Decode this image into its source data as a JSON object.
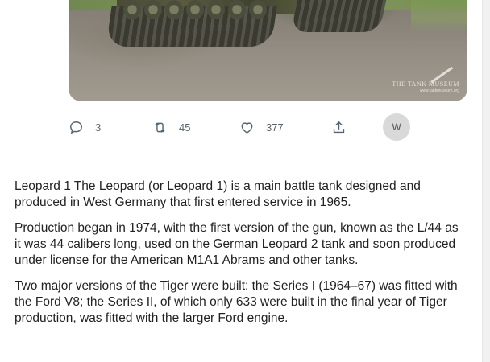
{
  "tweet": {
    "image": {
      "watermark_name": "THE TANK MUSEUM",
      "watermark_url": "www.tankmuseum.org"
    },
    "actions": {
      "reply_count": "3",
      "retweet_count": "45",
      "like_count": "377",
      "avatar_letter": "W"
    },
    "icons": {
      "reply": "comment-bubble-icon",
      "retweet": "retweet-icon",
      "like": "heart-icon",
      "share": "share-upload-icon"
    }
  },
  "article": {
    "paragraphs": [
      "Leopard 1 The Leopard (or Leopard 1) is a main battle tank designed and produced in West Germany that first entered service in 1965.",
      "Production began in 1974, with the first version of the gun, known as the L/44 as it was 44 calibers long, used on the German Leopard 2 tank and soon produced under license for the American M1A1 Abrams and other tanks.",
      "Two major versions of the Tiger were built: the Series I (1964–67) was fitted with the Ford V8; the Series II, of which only 633 were built in the final year of Tiger production, was fitted with the larger Ford engine."
    ]
  },
  "colors": {
    "icon_gray": "#536471",
    "text": "#222222",
    "avatar_bg": "#d9d9d9"
  }
}
